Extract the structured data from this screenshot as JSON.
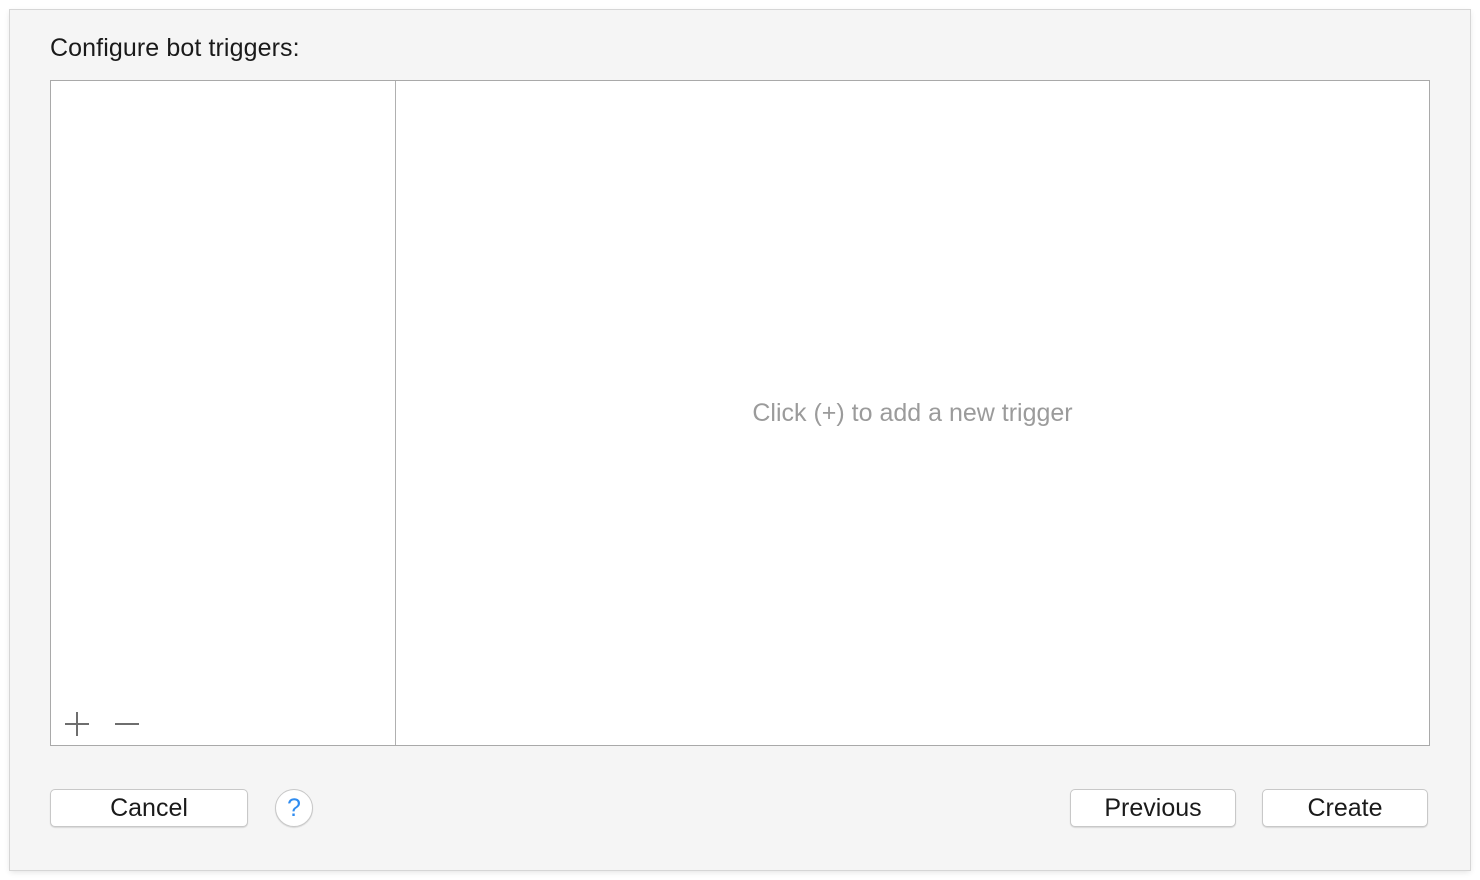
{
  "dialog": {
    "title": "Configure bot triggers:"
  },
  "triggers": {
    "items": [],
    "empty_message": "Click (+) to add a new trigger",
    "add_icon": "plus-icon",
    "remove_icon": "minus-icon"
  },
  "footer": {
    "cancel_label": "Cancel",
    "help_label": "?",
    "previous_label": "Previous",
    "create_label": "Create"
  },
  "colors": {
    "sheet_background": "#f5f5f5",
    "help_accent": "#2f8cf0",
    "placeholder_text": "#9b9b9b"
  }
}
